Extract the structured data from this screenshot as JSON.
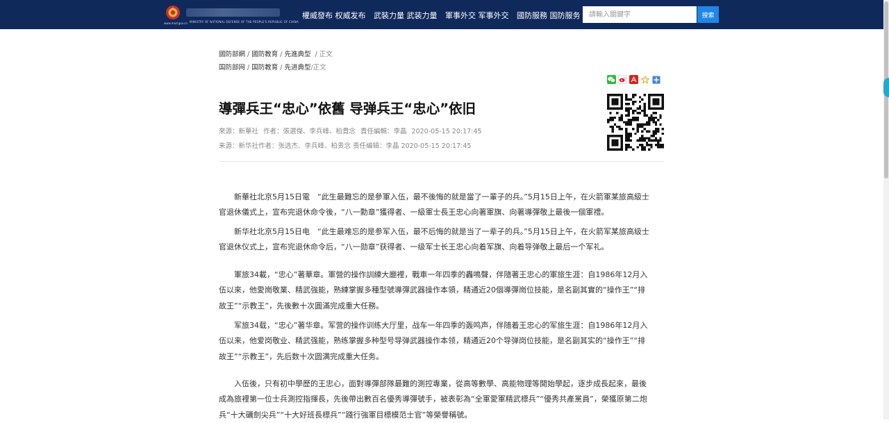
{
  "header": {
    "site_en": "MINISTRY OF NATIONAL DEFENSE OF THE PEOPLE'S REPUBLIC OF CHINA",
    "site_url": "www.mod.gov.cn",
    "nav": [
      "權威發布 权威发布",
      "武裝力量 武装力量",
      "軍事外交 军事外交",
      "國防服務 国防服务"
    ],
    "search": {
      "placeholder": "請輸入關鍵字",
      "button": "搜索"
    }
  },
  "breadcrumb_trad": {
    "items": [
      "國防部網",
      "國防教育",
      "先進典型"
    ],
    "current": "正文"
  },
  "breadcrumb_simp": {
    "items": [
      "国防部网",
      "国防教育",
      "先进典型"
    ],
    "current": "正文"
  },
  "article": {
    "title": "導彈兵王“忠心”依舊 导弹兵王“忠心”依旧",
    "meta_trad": {
      "source": "來源：新華社",
      "author": "作者：張選傑、李兵峰、柏貴念",
      "editor": "責任編輯：李晶",
      "date": "2020-05-15 20:17:45"
    },
    "meta_simp": "来源：新华社作者：张选杰、李兵峰、柏贵念 责任编辑：李晶 2020-05-15 20:17:45",
    "paragraphs": [
      "新華社北京5月15日電　“此生最難忘的是參軍入伍，最不後悔的就是當了一輩子的兵。”5月15日上午，在火箭軍某旅高級士官退休儀式上，宣布完退休命令後，“八一勳章”獲得者、一級軍士長王忠心向著軍旗、向著導彈敬上最後一個軍禮。",
      "新华社北京5月15日电　“此生最难忘的是参军入伍，最不后悔的就是当了一辈子的兵。”5月15日上午，在火箭军某旅高级士官退休仪式上，宣布完退休命令后，“八一勋章”获得者、一级军士长王忠心向着军旗、向着导弹敬上最后一个军礼。",
      "軍旅34載，“忠心”著華章。軍營的操作訓練大廳裡，戰車一年四季的轟鳴聲，伴隨著王忠心的軍旅生涯：自1986年12月入伍以來，他愛崗敬業、精武強能，熟練掌握多種型號導彈武器操作本領，精通近20個導彈崗位技能，是名副其實的“操作王”“排故王”“示教王”，先後數十次圓滿完成重大任務。",
      "军旅34载，“忠心”著华章。军营的操作训练大厅里，战车一年四季的轰鸣声，伴随着王忠心的军旅生涯：自1986年12月入伍以来，他爱岗敬业、精武强能，熟练掌握多种型号导弹武器操作本领，精通近20个导弹岗位技能，是名副其实的“操作王”“排故王”“示教王”，先后数十次圆满完成重大任务。",
      "入伍後，只有初中學歷的王忠心，面對導彈部隊最難的測控專業，從高等數學、高能物理等開始學起，逐步成長起來，最後成為旅裡第一位士兵測控指揮長，先後帶出數百名優秀導彈號手，被表彰為“全軍愛軍精武標兵”“優秀共產黨員”，榮獲原第二炮兵“十大礪劍尖兵”“十大好班長標兵”“踐行強軍目標模范士官”等榮譽稱號。"
    ]
  },
  "colors": {
    "header_bg": "#10295b",
    "search_button": "#1f86e8"
  },
  "icons": [
    "national-emblem-icon",
    "wechat-icon",
    "weibo-icon",
    "pdf-icon",
    "favorite-star-icon",
    "more-share-icon",
    "qr-code"
  ]
}
